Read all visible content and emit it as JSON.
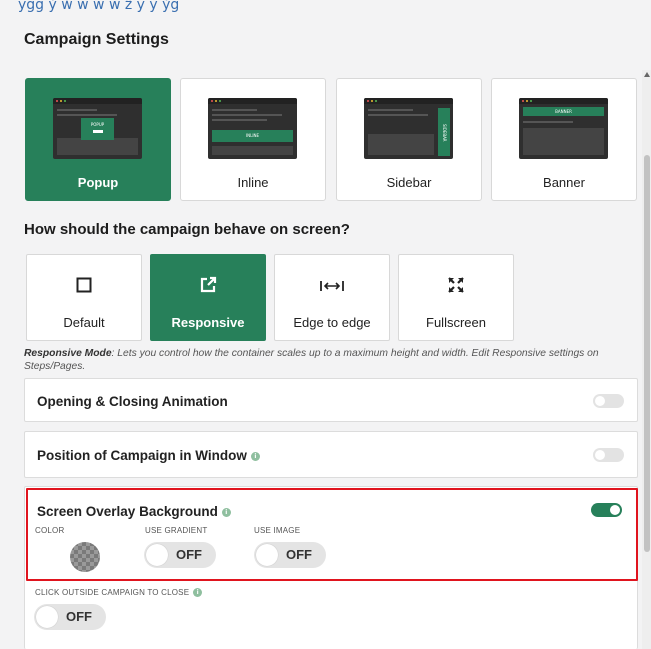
{
  "top_strip_text": "ẏgg ẙ ẘ ẅ ẃ ẁ ẑ ẏ ẏ ẙg",
  "title": "Campaign Settings",
  "campaign_types": [
    {
      "label": "Popup",
      "thumb_text": "POPUP",
      "active": true
    },
    {
      "label": "Inline",
      "thumb_text": "INLINE",
      "active": false
    },
    {
      "label": "Sidebar",
      "thumb_text": "SIDEBAR",
      "active": false
    },
    {
      "label": "Banner",
      "thumb_text": "BANNER",
      "active": false
    }
  ],
  "behavior_heading": "How should the campaign behave on screen?",
  "behaviors": [
    {
      "label": "Default",
      "icon": "square-outline-icon",
      "glyph": "☐",
      "active": false
    },
    {
      "label": "Responsive",
      "icon": "external-resize-icon",
      "glyph": "⇗",
      "active": true
    },
    {
      "label": "Edge to edge",
      "icon": "horizontal-arrows-icon",
      "glyph": "|↔|",
      "active": false
    },
    {
      "label": "Fullscreen",
      "icon": "expand-arrows-icon",
      "glyph": "⤧",
      "active": false
    }
  ],
  "note": {
    "lead": "Responsive Mode",
    "text": ": Lets you control how the container scales up to a maximum height and width. Edit Responsive settings on Steps/Pages."
  },
  "panels": {
    "animation": {
      "title": "Opening & Closing Animation",
      "enabled": false
    },
    "position": {
      "title": "Position of Campaign in Window",
      "enabled": false
    },
    "overlay": {
      "title": "Screen Overlay Background",
      "enabled": true,
      "color_label": "COLOR",
      "gradient_label": "USE GRADIENT",
      "gradient_value": "OFF",
      "image_label": "USE IMAGE",
      "image_value": "OFF"
    },
    "click_outside": {
      "label": "CLICK OUTSIDE CAMPAIGN TO CLOSE",
      "value": "OFF"
    }
  },
  "colors": {
    "accent": "#27805a",
    "highlight": "#e0141e"
  }
}
